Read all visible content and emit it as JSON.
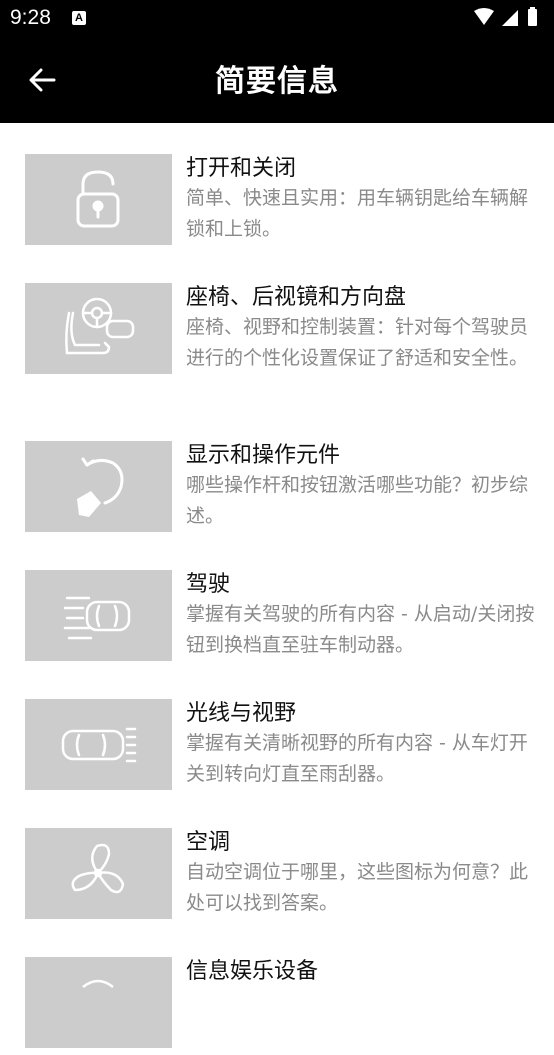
{
  "status": {
    "time": "9:28",
    "notif": "A"
  },
  "appbar": {
    "title": "简要信息"
  },
  "items": [
    {
      "title": "打开和关闭",
      "desc": "简单、快速且实用：用车辆钥匙给车辆解锁和上锁。",
      "icon": "lock-icon"
    },
    {
      "title": "座椅、后视镜和方向盘",
      "desc": "座椅、视野和控制装置：针对每个驾驶员进行的个性化设置保证了舒适和安全性。",
      "icon": "seat-steering-icon"
    },
    {
      "title": "显示和操作元件",
      "desc": "哪些操作杆和按钮激活哪些功能？初步综述。",
      "icon": "touch-control-icon"
    },
    {
      "title": "驾驶",
      "desc": "掌握有关驾驶的所有内容 - 从启动/关闭按钮到换档直至驻车制动器。",
      "icon": "car-driving-icon"
    },
    {
      "title": "光线与视野",
      "desc": "掌握有关清晰视野的所有内容 - 从车灯开关到转向灯直至雨刮器。",
      "icon": "car-lights-icon"
    },
    {
      "title": "空调",
      "desc": "自动空调位于哪里，这些图标为何意？此处可以找到答案。",
      "icon": "fan-icon"
    },
    {
      "title": "信息娱乐设备",
      "desc": "",
      "icon": "infotainment-icon"
    }
  ]
}
